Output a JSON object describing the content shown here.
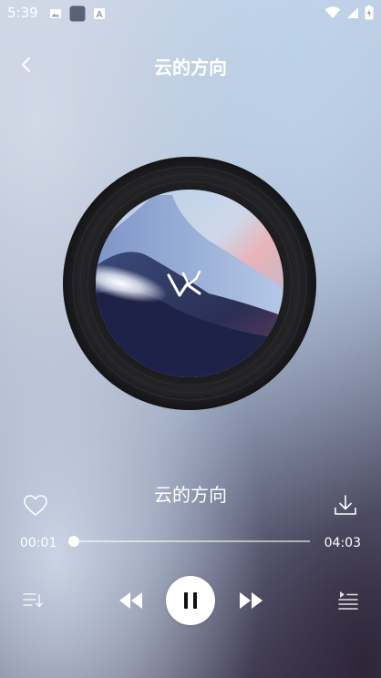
{
  "status_bar": {
    "time": "5:39",
    "left_icons": [
      "image-icon",
      "app-square-icon",
      "app-a-icon"
    ],
    "right_icons": [
      "wifi-icon",
      "signal-icon",
      "battery-icon"
    ]
  },
  "header": {
    "title": "云的方向",
    "back_icon": "chevron-left-icon"
  },
  "player": {
    "song_title": "云的方向",
    "current_time": "00:01",
    "total_time": "04:03",
    "progress_fraction": 0.004,
    "is_playing": true
  },
  "controls": {
    "like_icon": "heart-outline-icon",
    "download_icon": "download-icon",
    "playlist_icon": "playlist-icon",
    "previous_icon": "rewind-icon",
    "pause_icon": "pause-icon",
    "next_icon": "fast-forward-icon",
    "queue_icon": "queue-icon"
  },
  "colors": {
    "accent": "#ffffff",
    "disc": "#1e1e20"
  }
}
